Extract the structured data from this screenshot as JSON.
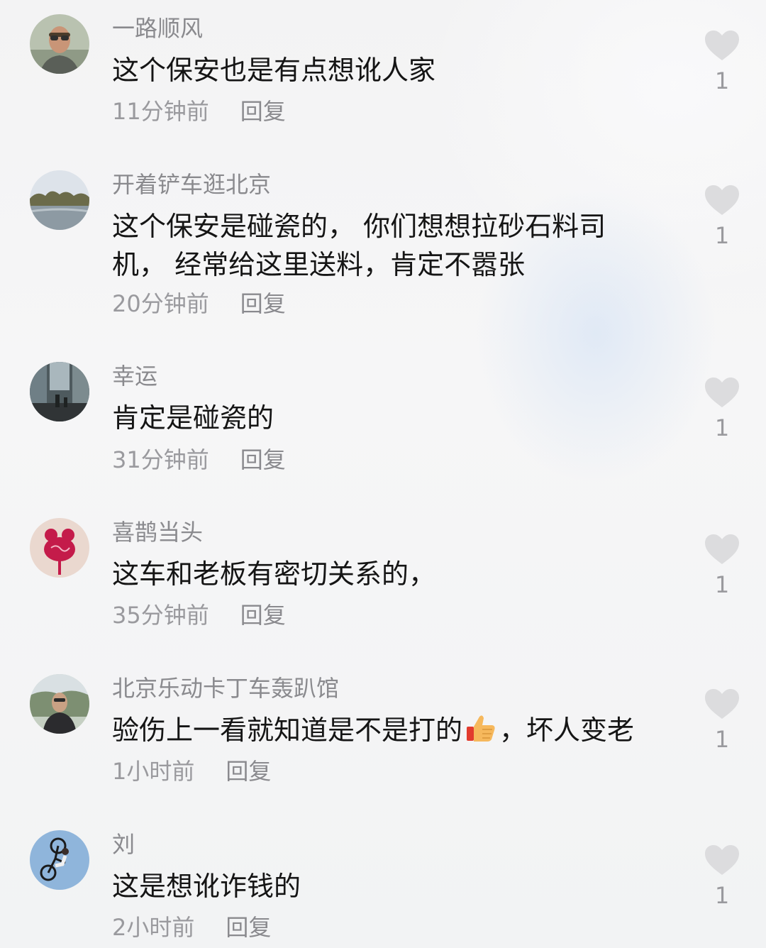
{
  "comments": [
    {
      "username": "一路顺风",
      "text": "这个保安也是有点想讹人家",
      "time": "11分钟前",
      "reply": "回复",
      "likes": "1",
      "avatar_icon": "man-sunglasses-photo"
    },
    {
      "username": "开着铲车逛北京",
      "text": "这个保安是碰瓷的， 你们想想拉砂石料司机， 经常给这里送料，肯定不嚣张",
      "time": "20分钟前",
      "reply": "回复",
      "likes": "1",
      "avatar_icon": "lake-landscape-photo"
    },
    {
      "username": "幸运",
      "text": "肯定是碰瓷的",
      "time": "31分钟前",
      "reply": "回复",
      "likes": "1",
      "avatar_icon": "city-street-photo"
    },
    {
      "username": "喜鹊当头",
      "text": "这车和老板有密切关系的，",
      "time": "35分钟前",
      "reply": "回复",
      "likes": "1",
      "avatar_icon": "red-flower-logo"
    },
    {
      "username": "北京乐动卡丁车轰趴馆",
      "text_before": "验伤上一看就知道是不是打的",
      "text_after": "，坏人变老",
      "emoji": "thumbs-up-emoji",
      "time": "1小时前",
      "reply": "回复",
      "likes": "1",
      "avatar_icon": "man-outdoor-photo"
    },
    {
      "username": "刘",
      "text": "这是想讹诈钱的",
      "time": "2小时前",
      "reply": "回复",
      "likes": "1",
      "avatar_icon": "bmx-rider-photo"
    }
  ],
  "colors": {
    "username": "#8a8a8e",
    "text": "#151515",
    "meta": "#9a9a9e",
    "heart": "#dcdcde"
  },
  "icons": {
    "like": "heart-icon"
  }
}
